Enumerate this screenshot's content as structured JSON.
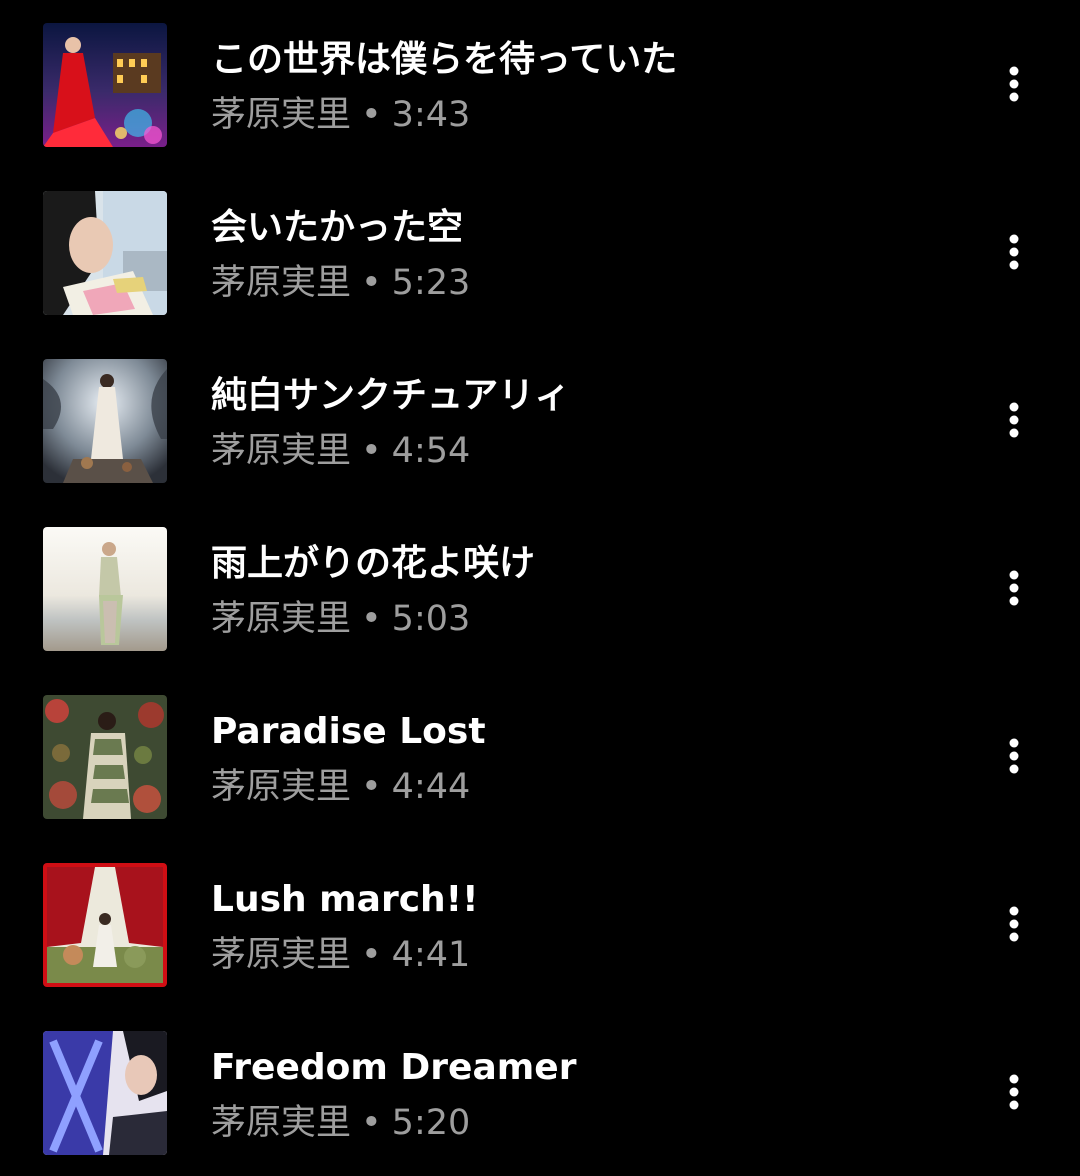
{
  "tracks": [
    {
      "title": "この世界は僕らを待っていた",
      "artist": "茅原実里",
      "separator": "•",
      "duration": "3:43",
      "thumbnail": "album-art-night-castle"
    },
    {
      "title": "会いたかった空",
      "artist": "茅原実里",
      "separator": "•",
      "duration": "5:23",
      "thumbnail": "album-art-portrait-sky"
    },
    {
      "title": "純白サンクチュアリィ",
      "artist": "茅原実里",
      "separator": "•",
      "duration": "4:54",
      "thumbnail": "album-art-white-dress-clouds"
    },
    {
      "title": "雨上がりの花よ咲け",
      "artist": "茅原実里",
      "separator": "•",
      "duration": "5:03",
      "thumbnail": "album-art-beach"
    },
    {
      "title": "Paradise Lost",
      "artist": "茅原実里",
      "separator": "•",
      "duration": "4:44",
      "thumbnail": "album-art-flowers"
    },
    {
      "title": "Lush march!!",
      "artist": "茅原実里",
      "separator": "•",
      "duration": "4:41",
      "thumbnail": "album-art-red-curtain"
    },
    {
      "title": "Freedom Dreamer",
      "artist": "茅原実里",
      "separator": "•",
      "duration": "5:20",
      "thumbnail": "album-art-blue-portrait"
    }
  ],
  "colors": {
    "background": "#000000",
    "title_text": "#ffffff",
    "meta_text": "#9e9e9e",
    "menu_icon": "#ffffff"
  },
  "icons": {
    "row_menu": "more-vertical-icon"
  }
}
